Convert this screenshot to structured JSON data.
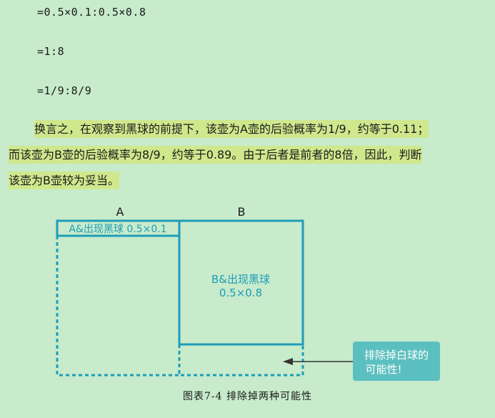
{
  "formulas": [
    "=0.5×0.1:0.5×0.8",
    "=1:8",
    "=1/9:8/9"
  ],
  "paragraph": {
    "line1": "换言之，在观察到黑球的前提下，该壶为A壶的后验概率为1/9，约等于0.11；",
    "line2": "而该壶为B壶的后验概率为8/9，约等于0.89。由于后者是前者的8倍，因此，判断",
    "line3": "该壶为B壶较为妥当。"
  },
  "figure": {
    "label_a": "A",
    "label_b": "B",
    "a_box_text": "A&出现黑球 0.5×0.1",
    "b_box_line1": "B&出现黑球",
    "b_box_line2": "0.5×0.8",
    "callout_line1": "排除掉白球的",
    "callout_line2": "可能性!",
    "caption": "图表7-4   排除掉两种可能性",
    "colors": {
      "accent": "#1f9cb8",
      "callout_bg": "#5cbfbf",
      "highlight": "#cfe88d",
      "background": "#c7ebcb"
    }
  }
}
